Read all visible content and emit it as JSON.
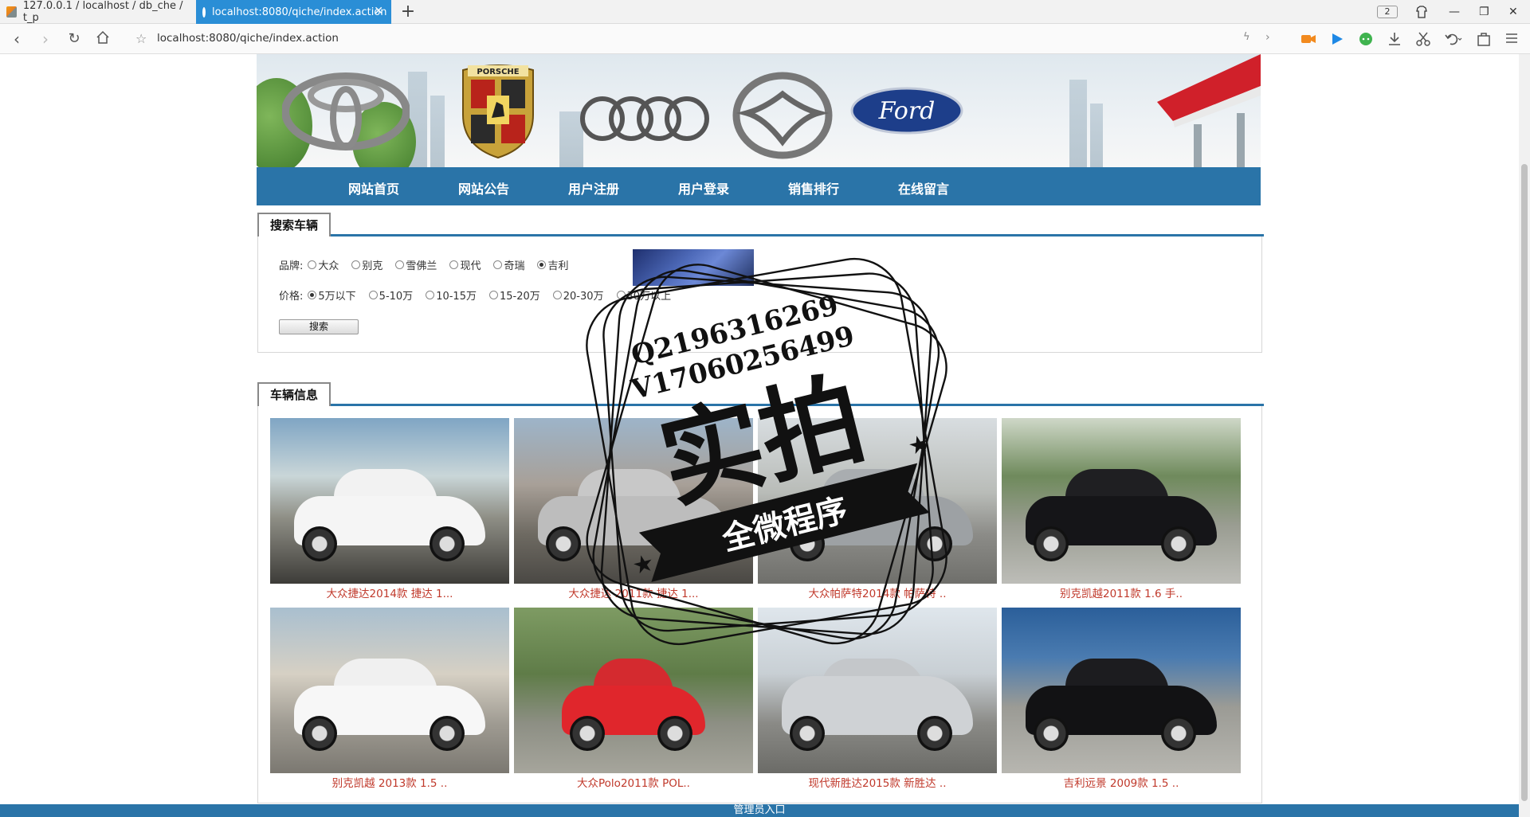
{
  "browser": {
    "tabs": [
      {
        "label": "127.0.0.1 / localhost / db_che / t_p",
        "active": false
      },
      {
        "label": "localhost:8080/qiche/index.action",
        "active": true
      }
    ],
    "tab_count_badge": "2",
    "url": "localhost:8080/qiche/index.action",
    "accent": "#2a8ed6"
  },
  "site": {
    "nav": [
      "网站首页",
      "网站公告",
      "用户注册",
      "用户登录",
      "销售排行",
      "在线留言"
    ],
    "nav_color": "#2a74a8"
  },
  "search": {
    "title": "搜索车辆",
    "brand_label": "品牌:",
    "brands": [
      {
        "label": "大众",
        "checked": false
      },
      {
        "label": "别克",
        "checked": false
      },
      {
        "label": "雪佛兰",
        "checked": false
      },
      {
        "label": "现代",
        "checked": false
      },
      {
        "label": "奇瑞",
        "checked": false
      },
      {
        "label": "吉利",
        "checked": true
      }
    ],
    "price_label": "价格:",
    "prices": [
      {
        "label": "5万以下",
        "checked": true
      },
      {
        "label": "5-10万",
        "checked": false
      },
      {
        "label": "10-15万",
        "checked": false
      },
      {
        "label": "15-20万",
        "checked": false
      },
      {
        "label": "20-30万",
        "checked": false
      },
      {
        "label": "30万以上",
        "checked": false
      }
    ],
    "button": "搜索"
  },
  "vehicles": {
    "title": "车辆信息",
    "items": [
      {
        "caption": "大众捷达2014款 捷达 1..."
      },
      {
        "caption": "大众捷达 2011款 捷达 1..."
      },
      {
        "caption": "大众帕萨特2014款 帕萨特 .."
      },
      {
        "caption": "别克凯越2011款 1.6 手.."
      },
      {
        "caption": "别克凯越 2013款 1.5 .."
      },
      {
        "caption": "大众Polo2011款 POL.."
      },
      {
        "caption": "现代新胜达2015款 新胜达 .."
      },
      {
        "caption": "吉利远景 2009款 1.5 .."
      }
    ]
  },
  "footer": {
    "admin_link": "管理员入口"
  },
  "watermark": {
    "line1": "Q2196316269",
    "line2": "V17060256499",
    "big": "实拍",
    "ribbon": "全微程序"
  }
}
